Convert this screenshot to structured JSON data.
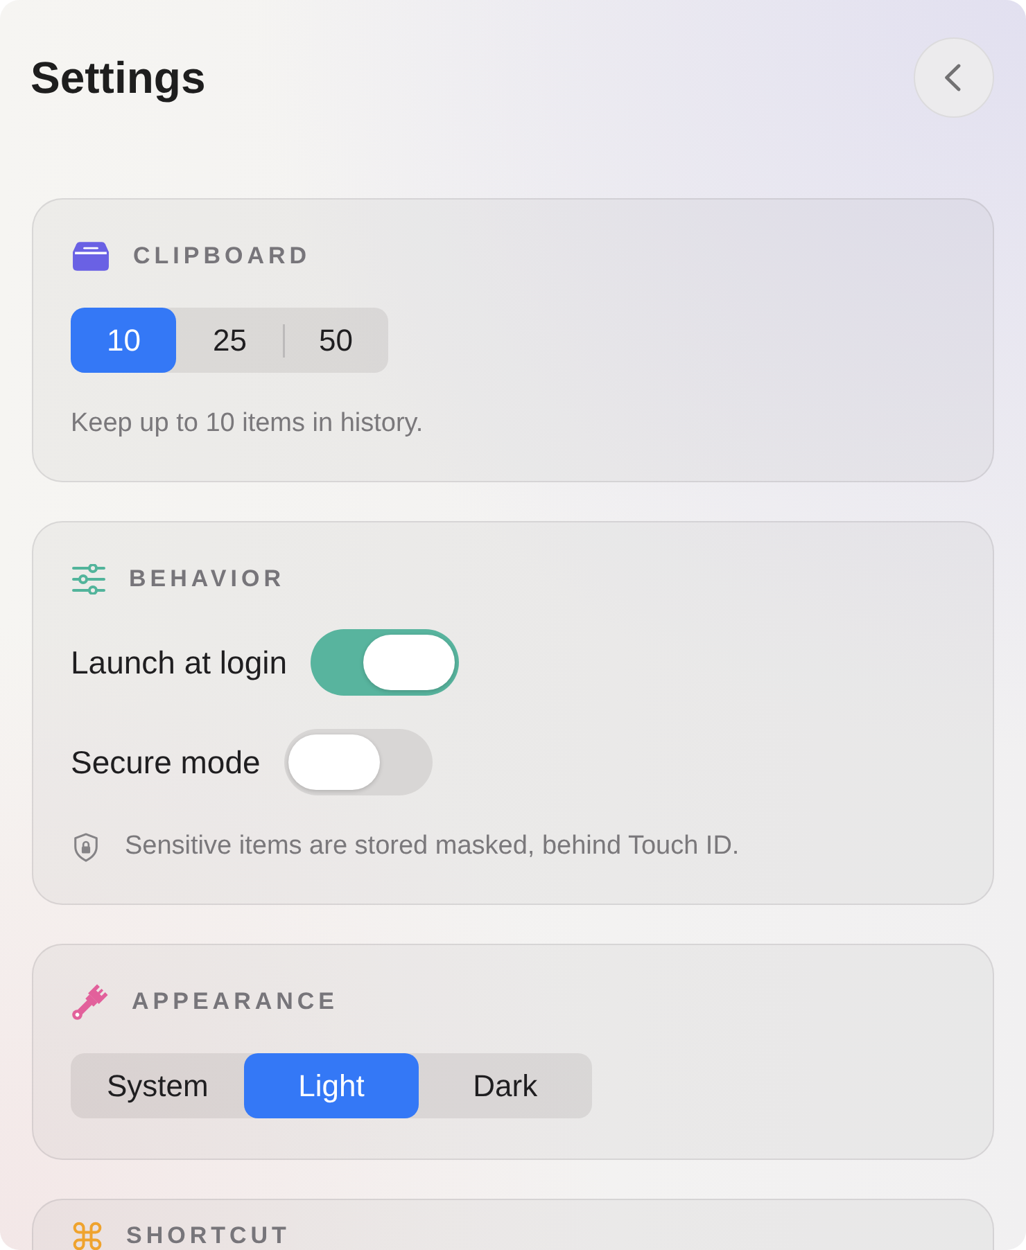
{
  "window": {
    "title": "Settings"
  },
  "sections": [
    {
      "title": "CLIPBOARD",
      "kind": "segmented",
      "options": [
        {
          "label": "10",
          "selected": true
        },
        {
          "label": "25",
          "selected": false
        },
        {
          "label": "50",
          "selected": false
        }
      ],
      "note": "Keep up to 10 items in history."
    },
    {
      "title": "BEHAVIOR",
      "kind": "toggles",
      "toggles": [
        {
          "label": "Launch at login",
          "on": true
        },
        {
          "label": "Secure mode",
          "on": false
        }
      ],
      "note": "Sensitive items are stored masked, behind Touch ID."
    },
    {
      "title": "APPEARANCE",
      "kind": "segmented",
      "options": [
        {
          "label": "System",
          "selected": false
        },
        {
          "label": "Light",
          "selected": true
        },
        {
          "label": "Dark",
          "selected": false
        }
      ]
    },
    {
      "title": "SHORTCUT"
    }
  ]
}
